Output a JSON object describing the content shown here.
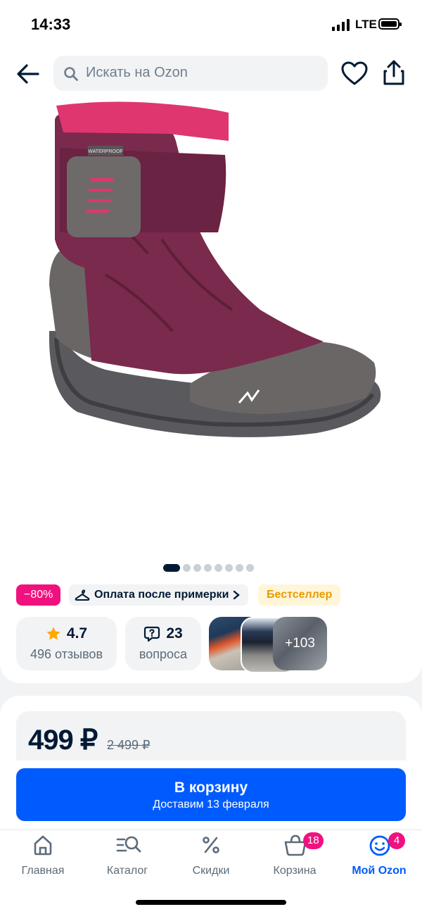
{
  "status_bar": {
    "time": "14:33",
    "network": "LTE"
  },
  "header": {
    "search_placeholder": "Искать на Ozon"
  },
  "gallery": {
    "slide_count": 8,
    "active_slide": 1,
    "brand_mark": "WATERPROOF"
  },
  "badges": {
    "discount": "−80%",
    "try_on": "Оплата после примерки",
    "bestseller": "Бестселлер"
  },
  "rating": {
    "score": "4.7",
    "reviews": "496 отзывов"
  },
  "questions": {
    "count": "23",
    "label": "вопроса"
  },
  "media": {
    "more_count": "+103"
  },
  "price": {
    "current": "499 ₽",
    "old": "2 499 ₽"
  },
  "cart_button": {
    "label": "В корзину",
    "delivery": "Доставим 13 февраля"
  },
  "bottom_nav": {
    "home": "Главная",
    "catalog": "Каталог",
    "discounts": "Скидки",
    "cart": "Корзина",
    "cart_badge": "18",
    "profile": "Мой Ozon",
    "profile_badge": "4"
  },
  "colors": {
    "accent": "#005bff",
    "discount": "#f1117e",
    "bestseller_text": "#e89b00",
    "text": "#001a34"
  }
}
